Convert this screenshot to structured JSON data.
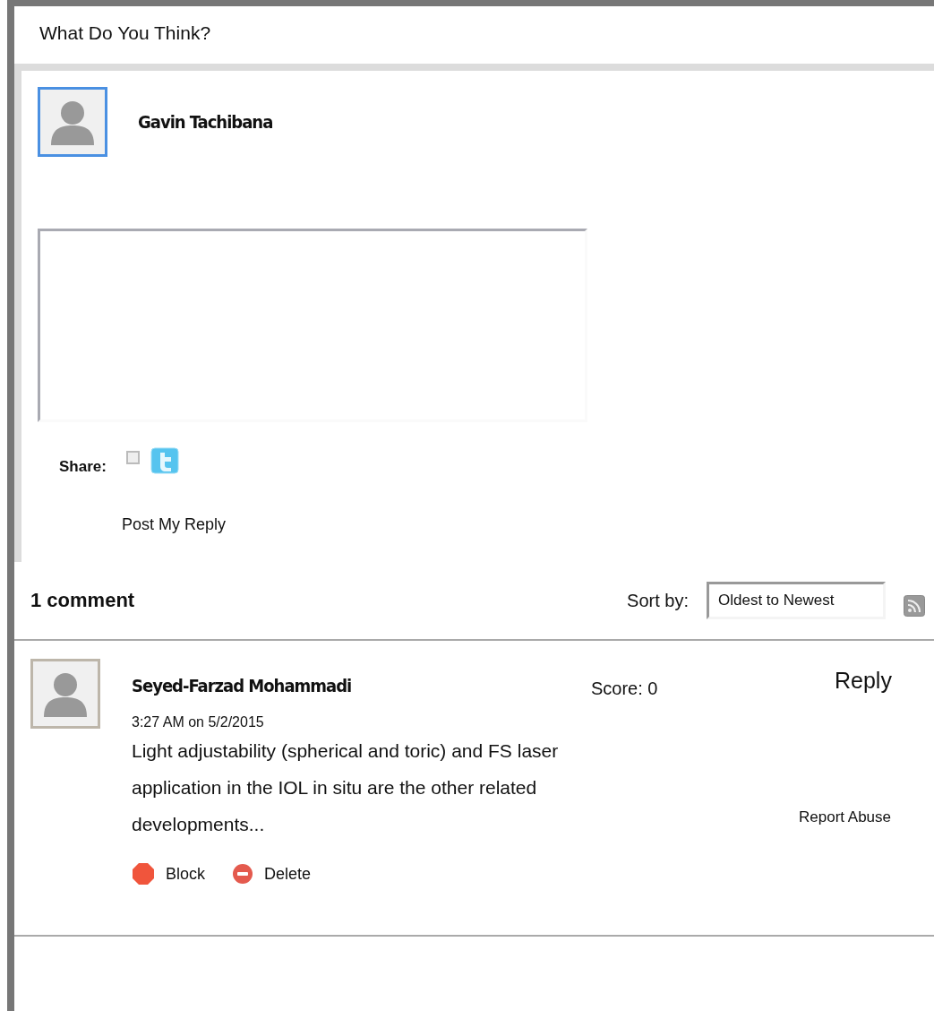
{
  "header": {
    "title": "What Do You Think?"
  },
  "composer": {
    "user_name": "Gavin Tachibana",
    "share_label": "Share:",
    "share_twitter_checked": false,
    "post_button": "Post My Reply"
  },
  "comments_header": {
    "count": "1 comment",
    "sort_label": "Sort by:",
    "sort_value": "Oldest to Newest"
  },
  "comments": [
    {
      "author": "Seyed-Farzad Mohammadi",
      "score": "Score: 0",
      "reply": "Reply",
      "time": "3:27 AM on 5/2/2015",
      "body": "Light adjustability (spherical and toric) and FS laser application in the IOL in situ are the other related developments...",
      "report": "Report Abuse",
      "block": "Block",
      "delete": "Delete"
    }
  ]
}
